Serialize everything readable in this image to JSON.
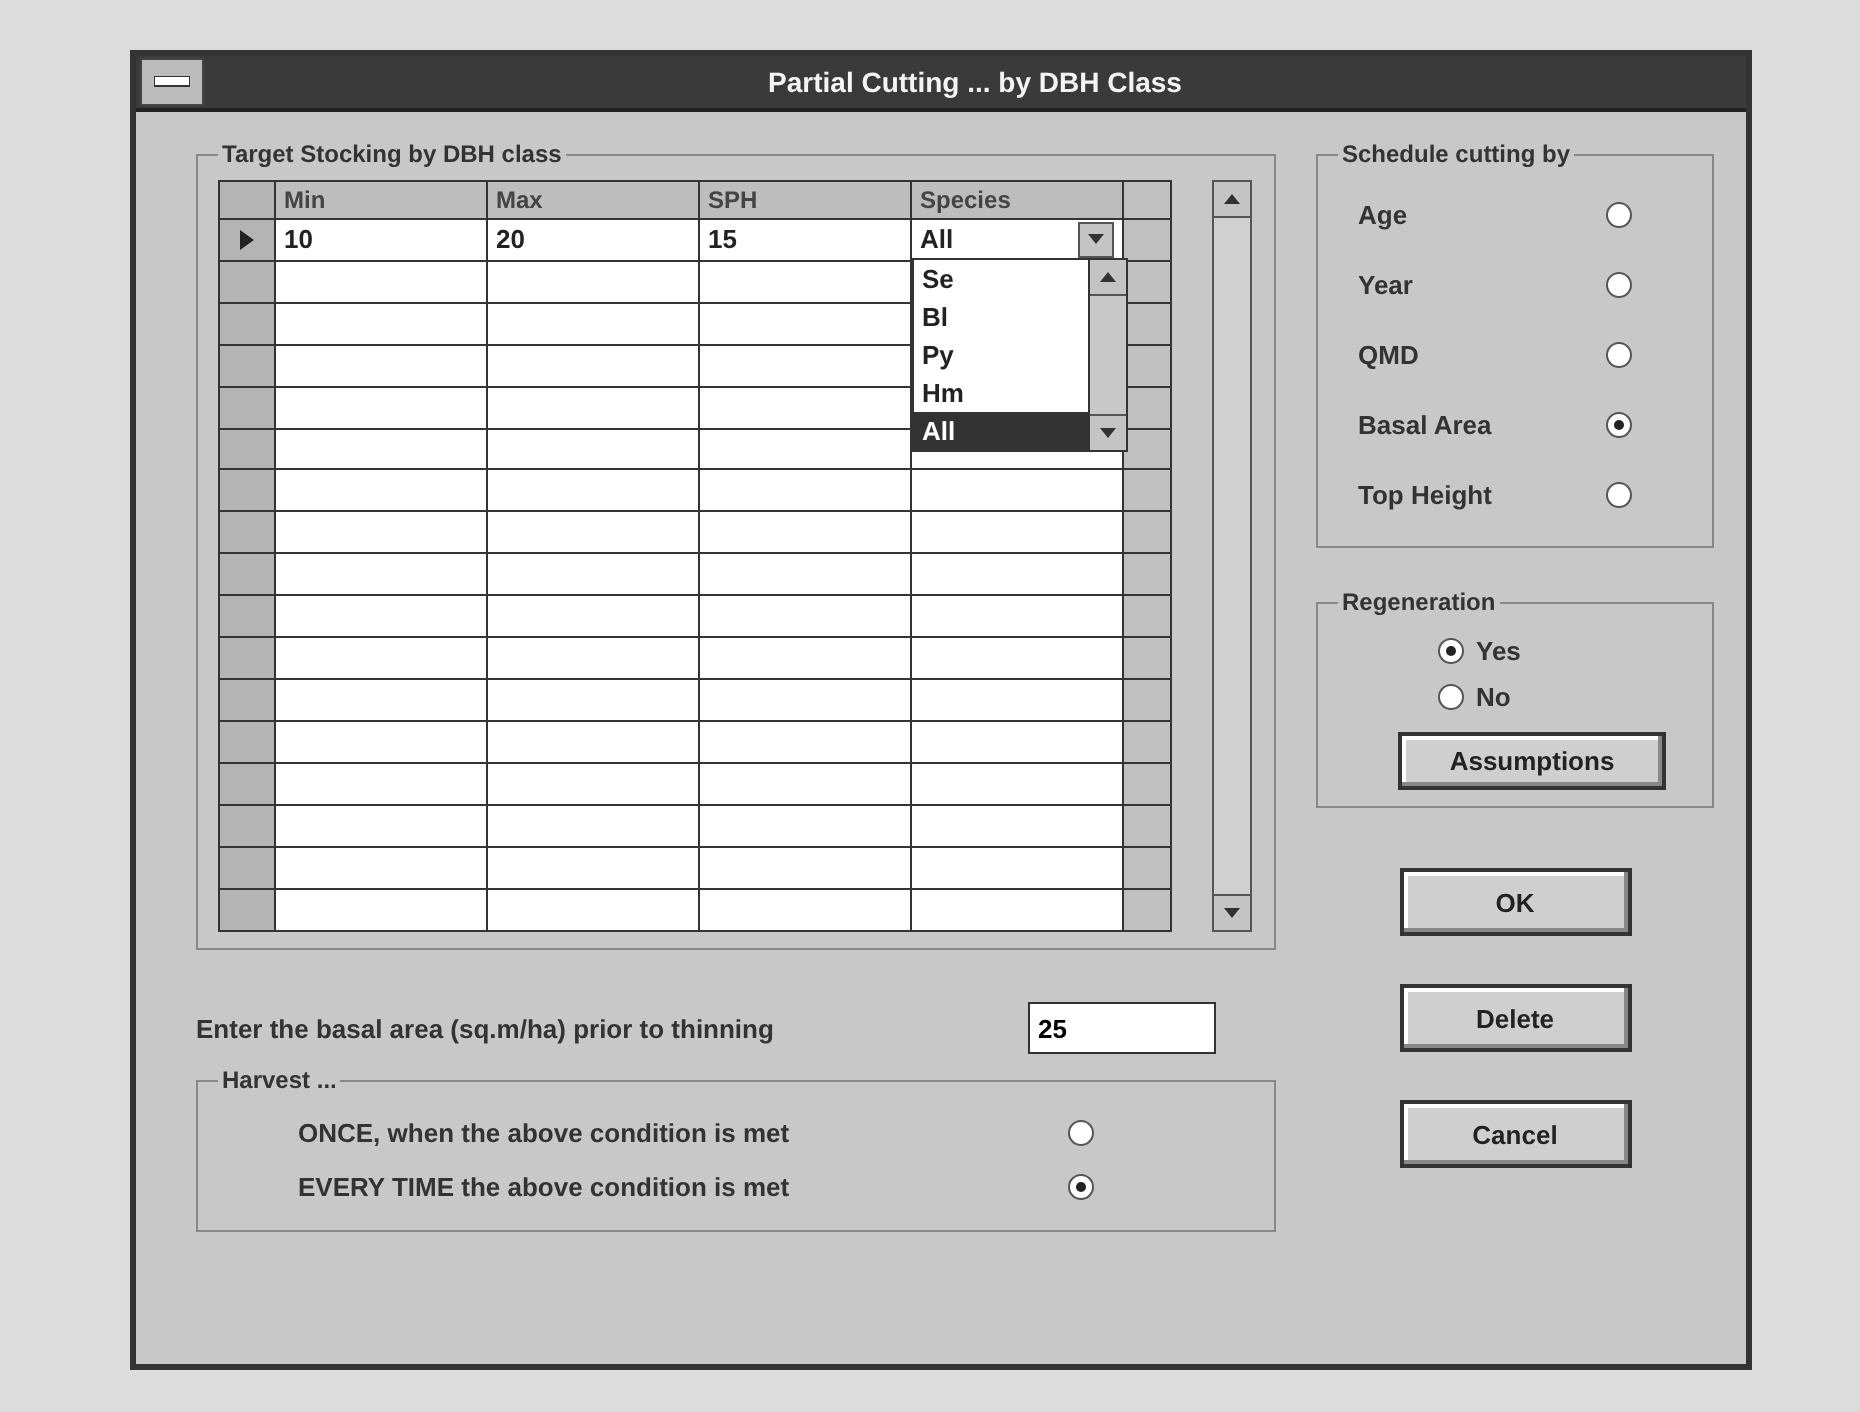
{
  "window": {
    "title": "Partial Cutting ... by DBH Class"
  },
  "target_stocking": {
    "label": "Target Stocking by DBH class",
    "columns": [
      "Min",
      "Max",
      "SPH",
      "Species"
    ],
    "rows": [
      {
        "selected": true,
        "cells": [
          "10",
          "20",
          "15",
          "All"
        ]
      },
      {
        "selected": false
      },
      {
        "selected": false
      },
      {
        "selected": false
      },
      {
        "selected": false
      },
      {
        "selected": false
      },
      {
        "selected": false
      },
      {
        "selected": false
      },
      {
        "selected": false
      },
      {
        "selected": false
      },
      {
        "selected": false
      },
      {
        "selected": false
      },
      {
        "selected": false
      },
      {
        "selected": false
      },
      {
        "selected": false
      },
      {
        "selected": false
      },
      {
        "selected": false
      }
    ],
    "species_dropdown": {
      "options": [
        {
          "label": "Se",
          "selected": false
        },
        {
          "label": "Bl",
          "selected": false
        },
        {
          "label": "Py",
          "selected": false
        },
        {
          "label": "Hm",
          "selected": false
        },
        {
          "label": "All",
          "selected": true
        }
      ]
    }
  },
  "schedule_cutting": {
    "label": "Schedule cutting  by",
    "options": [
      {
        "label": "Age",
        "selected": false
      },
      {
        "label": "Year",
        "selected": false
      },
      {
        "label": "QMD",
        "selected": false
      },
      {
        "label": "Basal Area",
        "selected": true
      },
      {
        "label": "Top Height",
        "selected": false
      }
    ]
  },
  "regeneration": {
    "label": "Regeneration",
    "options": [
      {
        "label": "Yes",
        "selected": true
      },
      {
        "label": "No",
        "selected": false
      }
    ],
    "button": "Assumptions"
  },
  "basal_area": {
    "label": "Enter the basal area (sq.m/ha) prior to thinning",
    "value": "25"
  },
  "harvest": {
    "label": "Harvest ...",
    "options": [
      {
        "label": "ONCE, when the above condition is met",
        "selected": false
      },
      {
        "label": "EVERY TIME the above condition is met",
        "selected": true
      }
    ]
  },
  "buttons": [
    "OK",
    "Delete",
    "Cancel"
  ]
}
